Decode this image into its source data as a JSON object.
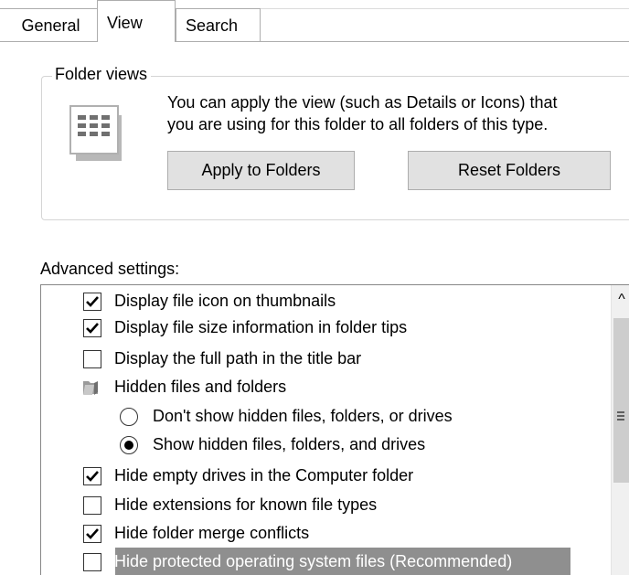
{
  "tabs": {
    "general": "General",
    "view": "View",
    "search": "Search"
  },
  "folder_views": {
    "legend": "Folder views",
    "description_line1": "You can apply the view (such as Details or Icons) that",
    "description_line2": "you are using for this folder to all folders of this type.",
    "apply_button": "Apply to Folders",
    "reset_button": "Reset Folders"
  },
  "advanced": {
    "label": "Advanced settings:",
    "items": [
      {
        "kind": "checkbox",
        "checked": true,
        "label": "Display file icon on thumbnails"
      },
      {
        "kind": "checkbox",
        "checked": true,
        "label": "Display file size information in folder tips"
      },
      {
        "kind": "checkbox",
        "checked": false,
        "label": "Display the full path in the title bar"
      },
      {
        "kind": "group",
        "icon": "folder-icon",
        "label": "Hidden files and folders"
      },
      {
        "kind": "radio",
        "checked": false,
        "label": "Don't show hidden files, folders, or drives"
      },
      {
        "kind": "radio",
        "checked": true,
        "label": "Show hidden files, folders, and drives"
      },
      {
        "kind": "checkbox",
        "checked": true,
        "label": "Hide empty drives in the Computer folder"
      },
      {
        "kind": "checkbox",
        "checked": false,
        "label": "Hide extensions for known file types"
      },
      {
        "kind": "checkbox",
        "checked": true,
        "label": "Hide folder merge conflicts"
      },
      {
        "kind": "checkbox",
        "checked": false,
        "label": "Hide protected operating system files (Recommended)",
        "selected": true
      }
    ]
  },
  "scrollbar": {
    "up_arrow": "^"
  },
  "colors": {
    "selection_highlight": "#8f8f8f",
    "button_face": "#e1e1e1",
    "border": "#adadad"
  }
}
